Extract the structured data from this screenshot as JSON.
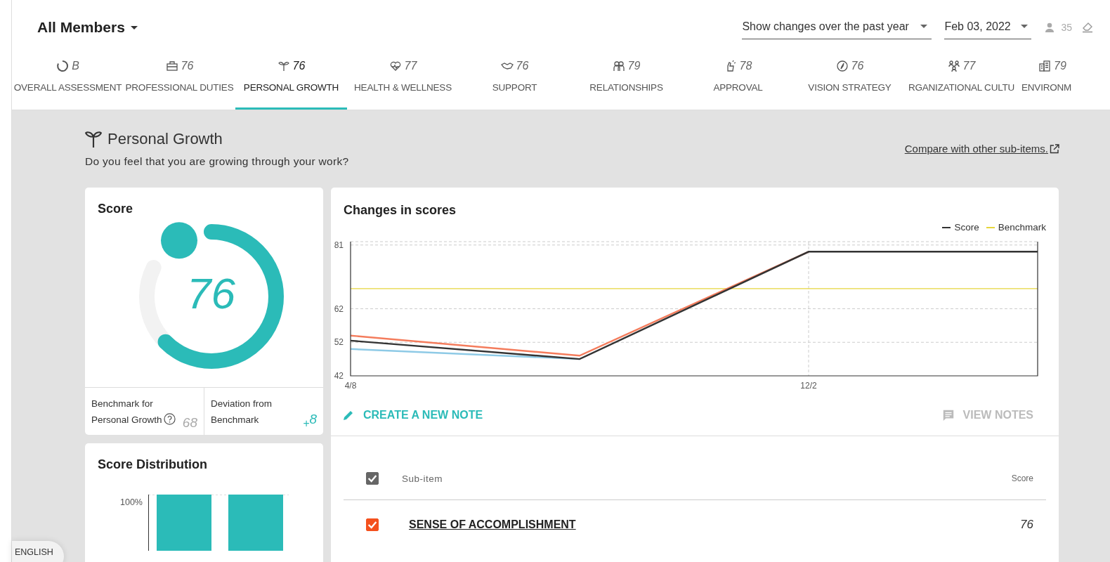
{
  "header": {
    "title": "All Members",
    "period_select": {
      "value": "Show changes over the past year"
    },
    "date_select": {
      "value": "Feb 03, 2022"
    },
    "member_count": "35"
  },
  "tabs": [
    {
      "score": "B",
      "label": "OVERALL ASSESSMENT",
      "selected": false
    },
    {
      "score": "76",
      "label": "PROFESSIONAL DUTIES",
      "selected": false
    },
    {
      "score": "76",
      "label": "PERSONAL GROWTH",
      "selected": true
    },
    {
      "score": "77",
      "label": "HEALTH & WELLNESS",
      "selected": false
    },
    {
      "score": "76",
      "label": "SUPPORT",
      "selected": false
    },
    {
      "score": "79",
      "label": "RELATIONSHIPS",
      "selected": false
    },
    {
      "score": "78",
      "label": "APPROVAL",
      "selected": false
    },
    {
      "score": "76",
      "label": "VISION STRATEGY",
      "selected": false
    },
    {
      "score": "77",
      "label": "RGANIZATIONAL CULTU",
      "selected": false
    },
    {
      "score": "79",
      "label": "ENVIRONM",
      "selected": false
    }
  ],
  "section": {
    "title": "Personal Growth",
    "question": "Do you feel that you are growing through your work?",
    "compare_link": "Compare with other sub-items."
  },
  "score_card": {
    "title": "Score",
    "score": "76",
    "level": 0.76,
    "benchmark_label": "Benchmark for Personal Growth",
    "benchmark": "68",
    "deviation_label": "Deviation from Benchmark",
    "deviation": "$_{+}$8"
  },
  "distribution": {
    "title": "Score Distribution",
    "y_label": "100%"
  },
  "changes": {
    "title": "Changes in scores",
    "create_note": "CREATE A NEW NOTE",
    "view_notes": "VIEW NOTES",
    "chart_data": {
      "type": "line",
      "grid": true,
      "categories": [
        "4/8",
        null,
        "12/2",
        null
      ],
      "ylim": [
        42,
        82
      ],
      "yticks": [
        42,
        52,
        62,
        81
      ],
      "series": [
        {
          "name": "Benchmark",
          "color": "#e6d63c",
          "values": [
            68,
            68,
            68,
            68
          ]
        },
        {
          "color": "#8ecae6",
          "values": [
            50,
            47,
            null,
            null
          ]
        },
        {
          "color": "#f47c5c",
          "values": [
            54,
            48,
            79,
            null
          ]
        },
        {
          "name": "Score",
          "color": "#333333",
          "values": [
            52.5,
            47,
            79,
            79
          ]
        }
      ]
    }
  },
  "subitems": {
    "select_all_checked": true,
    "columns": [
      "Sub-item",
      "Score"
    ],
    "rows": [
      {
        "name": "SENSE OF ACCOMPLISHMENT",
        "score": "76",
        "checked": true
      }
    ]
  },
  "language": "ENGLISH"
}
